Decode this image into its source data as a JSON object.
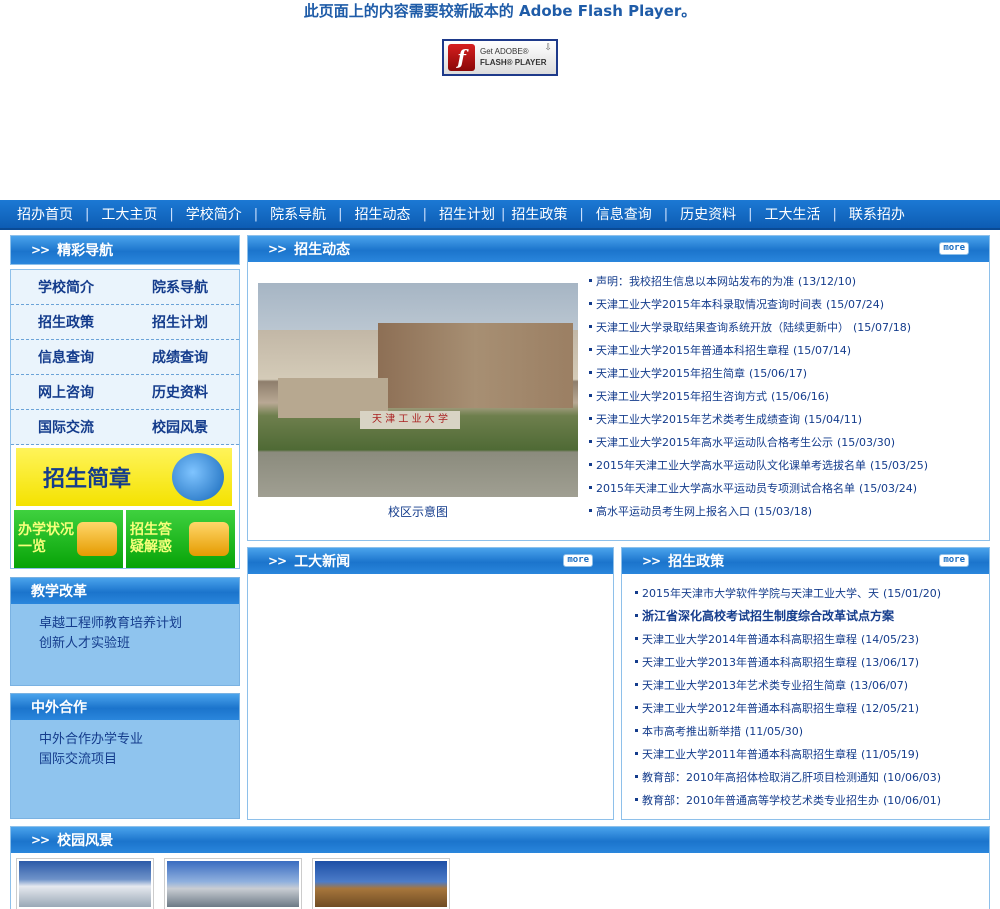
{
  "flash": {
    "message": "此页面上的内容需要较新版本的 Adobe Flash Player。",
    "badge_line1": "Get ADOBE®",
    "badge_line2": "FLASH® PLAYER"
  },
  "nav": {
    "items": [
      "招办首页",
      "工大主页",
      "学校简介",
      "院系导航",
      "招生动态",
      "招生计划",
      "招生政策",
      "信息查询",
      "历史资料",
      "工大生活",
      "联系招办"
    ]
  },
  "sidebar": {
    "header": "精彩导航",
    "grid": [
      [
        "学校简介",
        "院系导航"
      ],
      [
        "招生政策",
        "招生计划"
      ],
      [
        "信息查询",
        "成绩查询"
      ],
      [
        "网上咨询",
        "历史资料"
      ],
      [
        "国际交流",
        "校园风景"
      ]
    ],
    "banner_main": "招生简章",
    "banner_left": [
      "办学状况",
      "一览"
    ],
    "banner_right": [
      "招生答",
      "疑解惑"
    ]
  },
  "reform": {
    "header": "教学改革",
    "links": [
      "卓越工程师教育培养计划",
      "创新人才实验班"
    ]
  },
  "cooperation": {
    "header": "中外合作",
    "links": [
      "中外合作办学专业",
      "国际交流项目"
    ]
  },
  "admissions": {
    "header": "招生动态",
    "more": "more",
    "photo_caption": "校区示意图",
    "items": [
      {
        "title": "声明：我校招生信息以本网站发布的为准",
        "date": "(13/12/10)"
      },
      {
        "title": "天津工业大学2015年本科录取情况查询时间表",
        "date": "(15/07/24)"
      },
      {
        "title": "天津工业大学录取结果查询系统开放（陆续更新中）",
        "date": "(15/07/18)"
      },
      {
        "title": "天津工业大学2015年普通本科招生章程",
        "date": "(15/07/14)"
      },
      {
        "title": "天津工业大学2015年招生简章",
        "date": "(15/06/17)"
      },
      {
        "title": "天津工业大学2015年招生咨询方式",
        "date": "(15/06/16)"
      },
      {
        "title": "天津工业大学2015年艺术类考生成绩查询",
        "date": "(15/04/11)"
      },
      {
        "title": "天津工业大学2015年高水平运动队合格考生公示",
        "date": "(15/03/30)"
      },
      {
        "title": "2015年天津工业大学高水平运动队文化课单考选拔名单",
        "date": "(15/03/25)"
      },
      {
        "title": "2015年天津工业大学高水平运动员专项测试合格名单",
        "date": "(15/03/24)"
      },
      {
        "title": "高水平运动员考生网上报名入口",
        "date": "(15/03/18)"
      }
    ]
  },
  "gongda_news": {
    "header": "工大新闻",
    "more": "more"
  },
  "policy": {
    "header": "招生政策",
    "more": "more",
    "items": [
      {
        "title": "2015年天津市大学软件学院与天津工业大学、天",
        "date": "(15/01/20)"
      },
      {
        "title": "浙江省深化高校考试招生制度综合改革试点方案",
        "date": "",
        "bold": true
      },
      {
        "title": "天津工业大学2014年普通本科高职招生章程",
        "date": "(14/05/23)"
      },
      {
        "title": "天津工业大学2013年普通本科高职招生章程",
        "date": "(13/06/17)"
      },
      {
        "title": "天津工业大学2013年艺术类专业招生简章",
        "date": "(13/06/07)"
      },
      {
        "title": "天津工业大学2012年普通本科高职招生章程",
        "date": "(12/05/21)"
      },
      {
        "title": "本市高考推出新举措",
        "date": "(11/05/30)"
      },
      {
        "title": "天津工业大学2011年普通本科高职招生章程",
        "date": "(11/05/19)"
      },
      {
        "title": "教育部：2010年高招体检取消乙肝项目检测通知",
        "date": "(10/06/03)"
      },
      {
        "title": "教育部：2010年普通高等学校艺术类专业招生办",
        "date": "(10/06/01)"
      }
    ]
  },
  "scenery": {
    "header": "校园风景"
  }
}
